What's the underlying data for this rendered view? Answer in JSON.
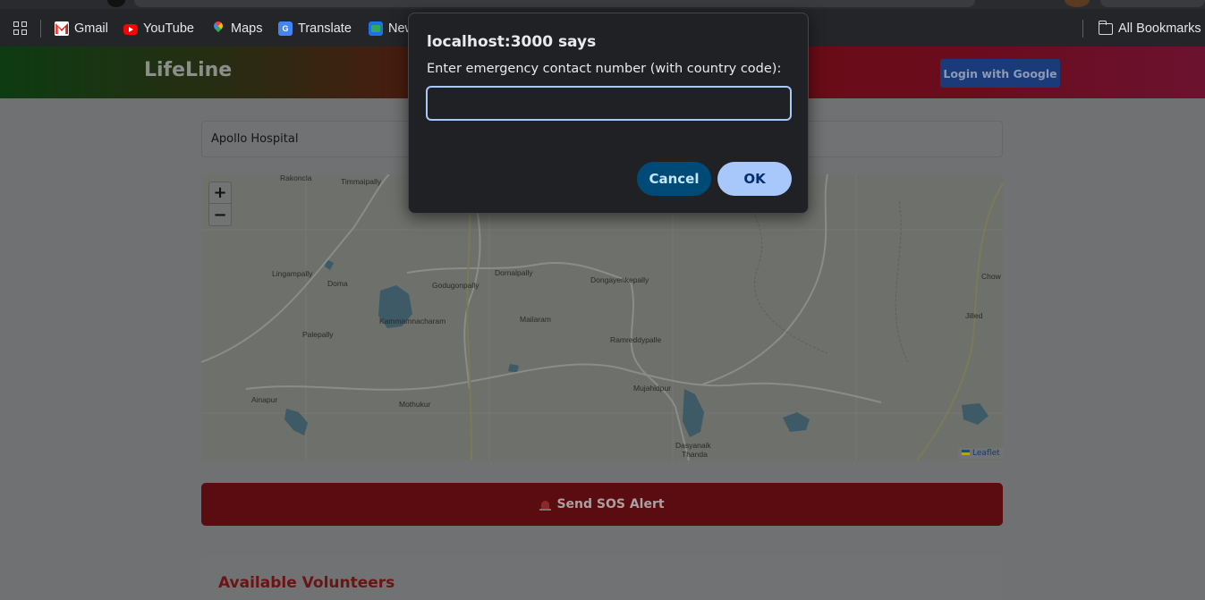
{
  "bookmarks": {
    "items": [
      {
        "label": "Gmail",
        "icon": "gmail-icon"
      },
      {
        "label": "YouTube",
        "icon": "youtube-icon"
      },
      {
        "label": "Maps",
        "icon": "maps-icon"
      },
      {
        "label": "Translate",
        "icon": "translate-icon"
      },
      {
        "label": "New",
        "icon": "news-icon"
      }
    ],
    "all_bookmarks": "All Bookmarks"
  },
  "app": {
    "brand": "LifeLine",
    "login_label": "Login with Google",
    "search_value": "Apollo Hospital",
    "sos_label": "Send SOS Alert",
    "volunteers_title": "Available Volunteers"
  },
  "map": {
    "zoom_in": "+",
    "zoom_out": "−",
    "attribution": "Leaflet",
    "places": [
      "Rakoncla",
      "Timmaipally",
      "Lingampally",
      "Doma",
      "Godugonpally",
      "Dornalpally",
      "Dongayenkepally",
      "Chow",
      "Jilled",
      "Kammamnacharam",
      "Mailaram",
      "Palepally",
      "Ramreddypalle",
      "Mujahidpur",
      "Ainapur",
      "Mothukur",
      "Dasyanaik",
      "Thanda"
    ]
  },
  "dialog": {
    "title": "localhost:3000 says",
    "message": "Enter emergency contact number (with country code):",
    "input_value": "",
    "cancel_label": "Cancel",
    "ok_label": "OK"
  },
  "colors": {
    "dialog_bg": "#202124",
    "ok_bg": "#a8c7fa",
    "cancel_bg": "#004a77",
    "sos_red": "#b71c1c"
  }
}
